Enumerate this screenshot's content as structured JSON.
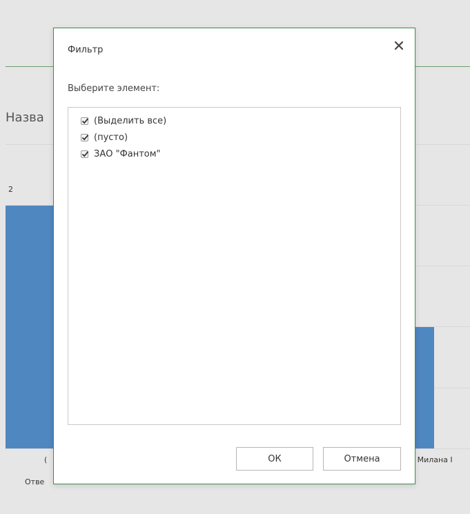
{
  "background": {
    "chart_title_fragment": "Назва",
    "y_tick_label": "2",
    "x_label_right_fragment": "  Милана I",
    "x_label_left_fragment": "Отве",
    "x_label_left_top_fragment": "(",
    "bar_color": "#4f87c1",
    "accent_line_color": "#6b9e6b"
  },
  "dialog": {
    "title": "Фильтр",
    "close_icon": "close-icon",
    "prompt": "Выберите элемент:",
    "items": [
      {
        "label": "(Выделить все)",
        "checked": true
      },
      {
        "label": "(пусто)",
        "checked": true
      },
      {
        "label": "ЗАО \"Фантом\"",
        "checked": true
      }
    ],
    "ok_label": "ОК",
    "cancel_label": "Отмена",
    "border_color": "#3f8a4f"
  }
}
